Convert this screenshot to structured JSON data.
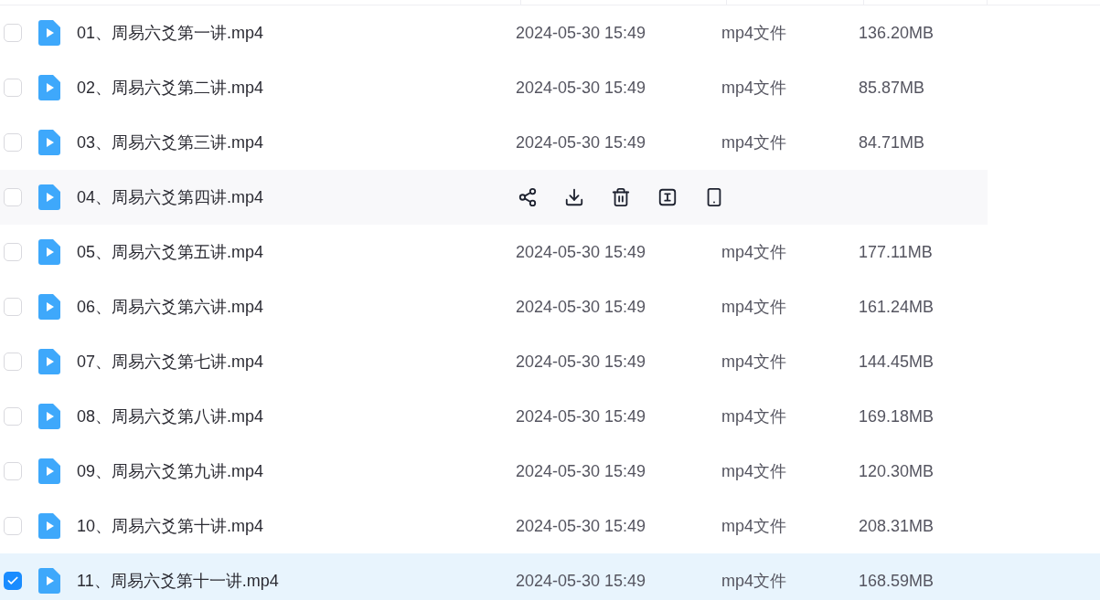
{
  "rows": [
    {
      "name": "01、周易六爻第一讲.mp4",
      "date": "2024-05-30 15:49",
      "type": "mp4文件",
      "size": "136.20MB",
      "selected": false,
      "hovered": false
    },
    {
      "name": "02、周易六爻第二讲.mp4",
      "date": "2024-05-30 15:49",
      "type": "mp4文件",
      "size": "85.87MB",
      "selected": false,
      "hovered": false
    },
    {
      "name": "03、周易六爻第三讲.mp4",
      "date": "2024-05-30 15:49",
      "type": "mp4文件",
      "size": "84.71MB",
      "selected": false,
      "hovered": false
    },
    {
      "name": "04、周易六爻第四讲.mp4",
      "selected": false,
      "hovered": true
    },
    {
      "name": "05、周易六爻第五讲.mp4",
      "date": "2024-05-30 15:49",
      "type": "mp4文件",
      "size": "177.11MB",
      "selected": false,
      "hovered": false
    },
    {
      "name": "06、周易六爻第六讲.mp4",
      "date": "2024-05-30 15:49",
      "type": "mp4文件",
      "size": "161.24MB",
      "selected": false,
      "hovered": false
    },
    {
      "name": "07、周易六爻第七讲.mp4",
      "date": "2024-05-30 15:49",
      "type": "mp4文件",
      "size": "144.45MB",
      "selected": false,
      "hovered": false
    },
    {
      "name": "08、周易六爻第八讲.mp4",
      "date": "2024-05-30 15:49",
      "type": "mp4文件",
      "size": "169.18MB",
      "selected": false,
      "hovered": false
    },
    {
      "name": "09、周易六爻第九讲.mp4",
      "date": "2024-05-30 15:49",
      "type": "mp4文件",
      "size": "120.30MB",
      "selected": false,
      "hovered": false
    },
    {
      "name": "10、周易六爻第十讲.mp4",
      "date": "2024-05-30 15:49",
      "type": "mp4文件",
      "size": "208.31MB",
      "selected": false,
      "hovered": false
    },
    {
      "name": "11、周易六爻第十一讲.mp4",
      "date": "2024-05-30 15:49",
      "type": "mp4文件",
      "size": "168.59MB",
      "selected": true,
      "hovered": false
    }
  ]
}
